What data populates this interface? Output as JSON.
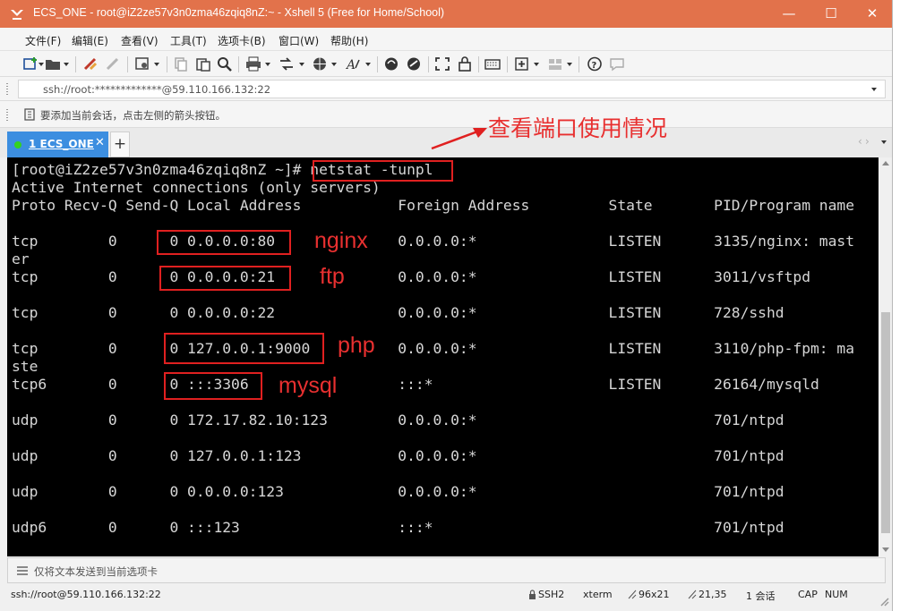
{
  "window": {
    "title": "ECS_ONE - root@iZ2ze57v3n0zma46zqiq8nZ:~ - Xshell 5 (Free for Home/School)",
    "controls": {
      "minimize": "—",
      "maximize": "☐",
      "close": "✕"
    }
  },
  "menubar": {
    "items": [
      "文件(F)",
      "编辑(E)",
      "查看(V)",
      "工具(T)",
      "选项卡(B)",
      "窗口(W)",
      "帮助(H)"
    ]
  },
  "toolbar": {
    "icons": [
      "new-session-icon",
      "open-folder-icon",
      "connect-icon",
      "disconnect-icon",
      "properties-icon",
      "copy-icon",
      "paste-icon",
      "find-icon",
      "print-icon",
      "transfer-icon",
      "globe-icon",
      "font-icon",
      "xftp-icon",
      "xmanager-icon",
      "fullscreen-icon",
      "lock-icon",
      "keyboard-icon",
      "new-tab-icon",
      "layout-icon",
      "help-icon",
      "chat-icon"
    ]
  },
  "address": {
    "value": "ssh://root:*************@59.110.166.132:22"
  },
  "hint": {
    "text": "要添加当前会话，点击左侧的箭头按钮。"
  },
  "tabs": {
    "active_label": "1 ECS_ONE",
    "close": "✕",
    "add": "+"
  },
  "terminal": {
    "lines": [
      "[root@iZ2ze57v3n0zma46zqiq8nZ ~]# netstat -tunpl",
      "Active Internet connections (only servers)",
      "Proto Recv-Q Send-Q Local Address           Foreign Address         State       PID/Program name",
      "",
      "tcp        0      0 0.0.0.0:80              0.0.0.0:*               LISTEN      3135/nginx: mast",
      "er",
      "tcp        0      0 0.0.0.0:21              0.0.0.0:*               LISTEN      3011/vsftpd",
      "",
      "tcp        0      0 0.0.0.0:22              0.0.0.0:*               LISTEN      728/sshd",
      "",
      "tcp        0      0 127.0.0.1:9000          0.0.0.0:*               LISTEN      3110/php-fpm: ma",
      "ste",
      "tcp6       0      0 :::3306                 :::*                    LISTEN      26164/mysqld",
      "",
      "udp        0      0 172.17.82.10:123        0.0.0.0:*                           701/ntpd",
      "",
      "udp        0      0 127.0.0.1:123           0.0.0.0:*                           701/ntpd",
      "",
      "udp        0      0 0.0.0.0:123             0.0.0.0:*                           701/ntpd",
      "",
      "udp6       0      0 :::123                  :::*                                701/ntpd"
    ]
  },
  "annotations": {
    "command_note": "查看端口使用情况",
    "nginx": "nginx",
    "ftp": "ftp",
    "php": "php",
    "mysql": "mysql",
    "color": "#e02020"
  },
  "sendbar": {
    "text": "仅将文本发送到当前选项卡"
  },
  "status": {
    "connection": "ssh://root@59.110.166.132:22",
    "protocol": "SSH2",
    "terminal_type": "xterm",
    "size": "96x21",
    "cursor": "21,35",
    "sessions": "1 会话",
    "caps": "CAP",
    "num": "NUM"
  },
  "colors": {
    "titlebar": "#e2724b",
    "tab_active": "#3c8ee0",
    "terminal_bg": "#000000",
    "terminal_fg": "#d6d6d6"
  }
}
